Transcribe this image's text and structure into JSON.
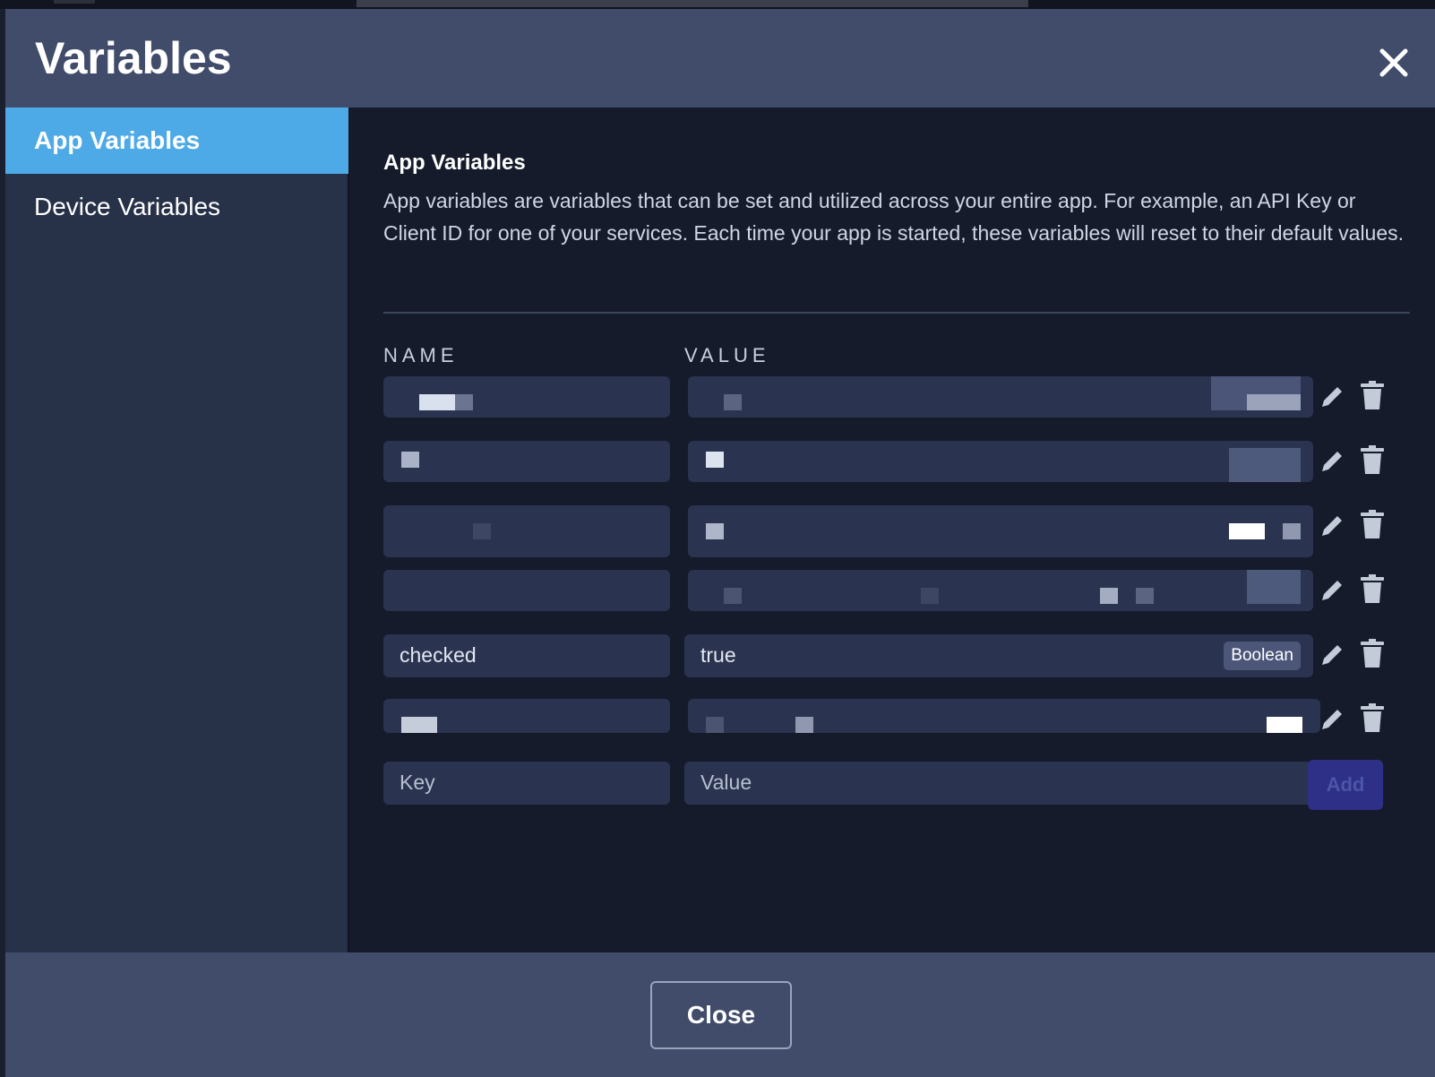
{
  "dialog": {
    "title": "Variables",
    "close_icon": "close-icon"
  },
  "sidebar": {
    "items": [
      {
        "label": "App Variables",
        "active": true
      },
      {
        "label": "Device Variables",
        "active": false
      }
    ]
  },
  "section": {
    "title": "App Variables",
    "description": "App variables are variables that can be set and utilized across your entire app. For example, an API Key or Client ID for one of your services. Each time your app is started, these variables will reset to their default values."
  },
  "table": {
    "headers": {
      "name": "NAME",
      "value": "VALUE"
    },
    "rows": [
      {
        "name": "",
        "value": "",
        "redacted": true
      },
      {
        "name": "",
        "value": "",
        "redacted": true
      },
      {
        "name": "",
        "value": "",
        "redacted": true
      },
      {
        "name": "",
        "value": "",
        "redacted": true
      },
      {
        "name": "checked",
        "value": "true",
        "type": "Boolean",
        "redacted": false
      },
      {
        "name": "",
        "value": "",
        "redacted": true
      }
    ],
    "row_actions": {
      "edit_icon": "pencil-icon",
      "delete_icon": "trash-icon"
    }
  },
  "new_variable": {
    "key_placeholder": "Key",
    "value_placeholder": "Value",
    "add_label": "Add"
  },
  "footer": {
    "close_label": "Close"
  },
  "colors": {
    "header_bg": "#414c6b",
    "sidebar_bg": "#273148",
    "active_item": "#4eaae6",
    "content_bg": "#151b2a",
    "cell_bg": "#2a3450",
    "add_button": "#2e2f86"
  }
}
